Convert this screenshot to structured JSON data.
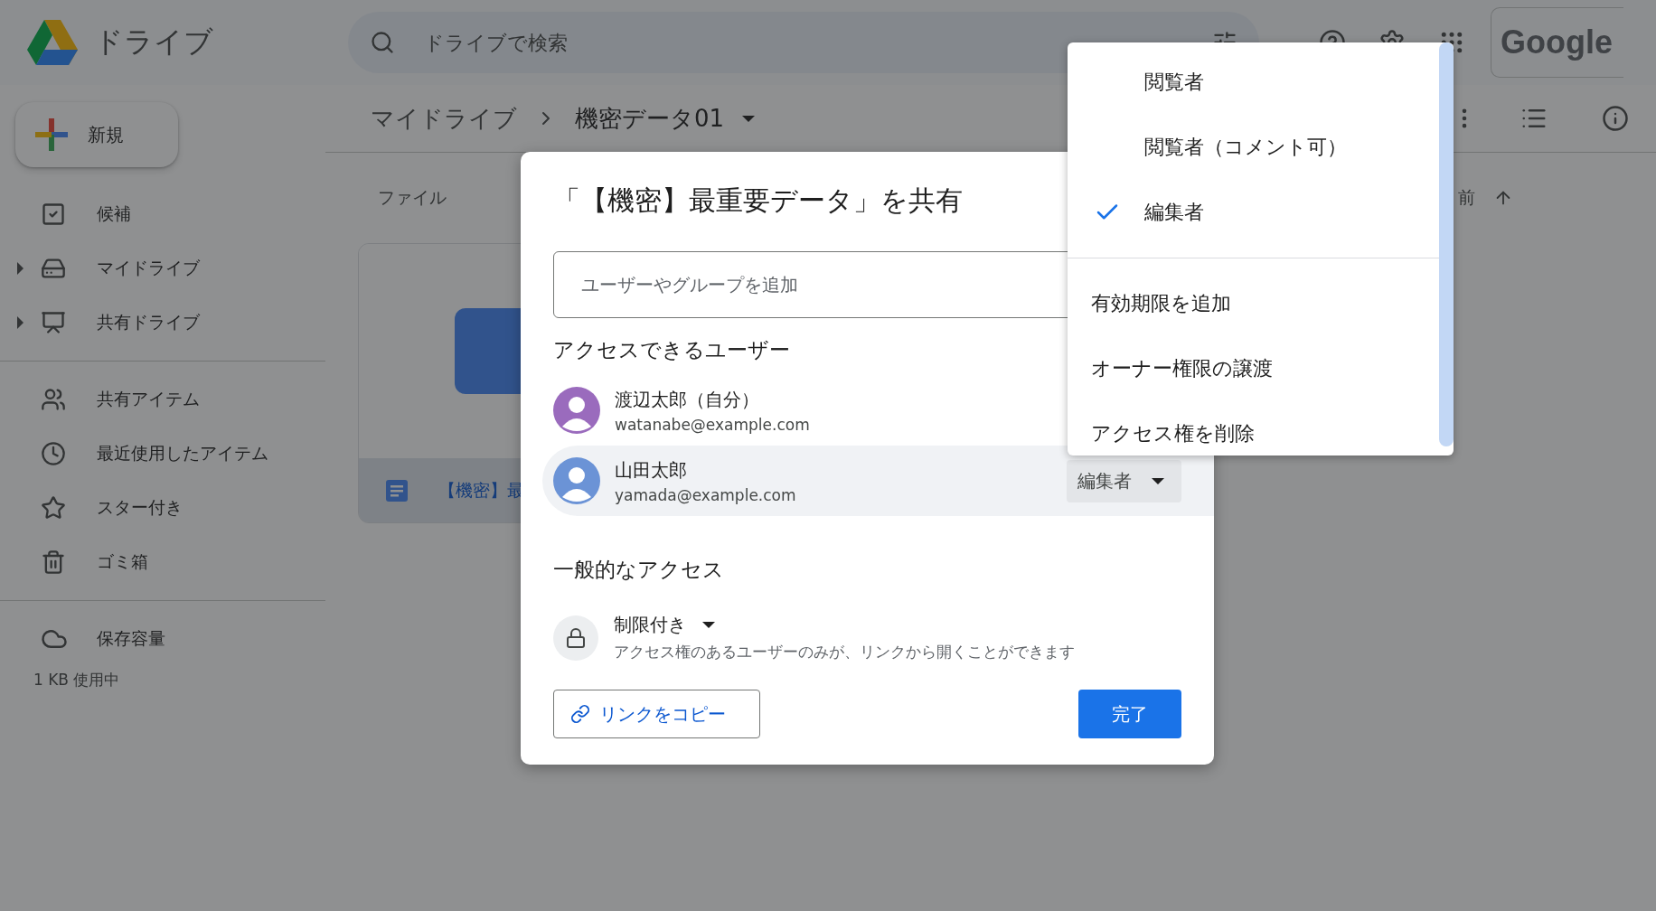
{
  "app": {
    "name": "ドライブ",
    "logo_text": "Google"
  },
  "search": {
    "placeholder": "ドライブで検索"
  },
  "new_button": {
    "label": "新規"
  },
  "sidebar": {
    "items": [
      {
        "label": "候補",
        "kind": "suggest",
        "expandable": false
      },
      {
        "label": "マイドライブ",
        "kind": "mydrive",
        "expandable": true
      },
      {
        "label": "共有ドライブ",
        "kind": "shared_drive",
        "expandable": true
      },
      {
        "label": "共有アイテム",
        "kind": "shared",
        "expandable": false
      },
      {
        "label": "最近使用したアイテム",
        "kind": "recent",
        "expandable": false
      },
      {
        "label": "スター付き",
        "kind": "starred",
        "expandable": false
      },
      {
        "label": "ゴミ箱",
        "kind": "trash",
        "expandable": false
      }
    ],
    "storage": {
      "label": "保存容量",
      "usage": "1 KB 使用中"
    }
  },
  "breadcrumb": [
    {
      "label": "マイドライブ"
    },
    {
      "label": "機密データ01"
    }
  ],
  "files": {
    "section_label": "ファイル",
    "sort_label": "前",
    "cards": [
      {
        "name": "【機密】最"
      }
    ]
  },
  "share_dialog": {
    "title": "「【機密】最重要データ」を共有",
    "input_placeholder": "ユーザーやグループを追加",
    "people_heading": "アクセスできるユーザー",
    "people": [
      {
        "name": "渡辺太郎（自分）",
        "email": "watanabe@example.com",
        "color": "#9a6bbd",
        "selected": false
      },
      {
        "name": "山田太郎",
        "email": "yamada@example.com",
        "color": "#6b93d6",
        "selected": true,
        "role": "編集者"
      }
    ],
    "general_heading": "一般的なアクセス",
    "access_level": "制限付き",
    "access_description": "アクセス権のあるユーザーのみが、リンクから開くことができます",
    "copy_link": "リンクをコピー",
    "done": "完了"
  },
  "role_menu": {
    "items": [
      {
        "label": "閲覧者",
        "kind": "role",
        "selected": false
      },
      {
        "label": "閲覧者（コメント可）",
        "kind": "role",
        "selected": false
      },
      {
        "label": "編集者",
        "kind": "role",
        "selected": true
      },
      {
        "label": "有効期限を追加",
        "kind": "action"
      },
      {
        "label": "オーナー権限の譲渡",
        "kind": "action"
      },
      {
        "label": "アクセス権を削除",
        "kind": "action"
      }
    ]
  }
}
